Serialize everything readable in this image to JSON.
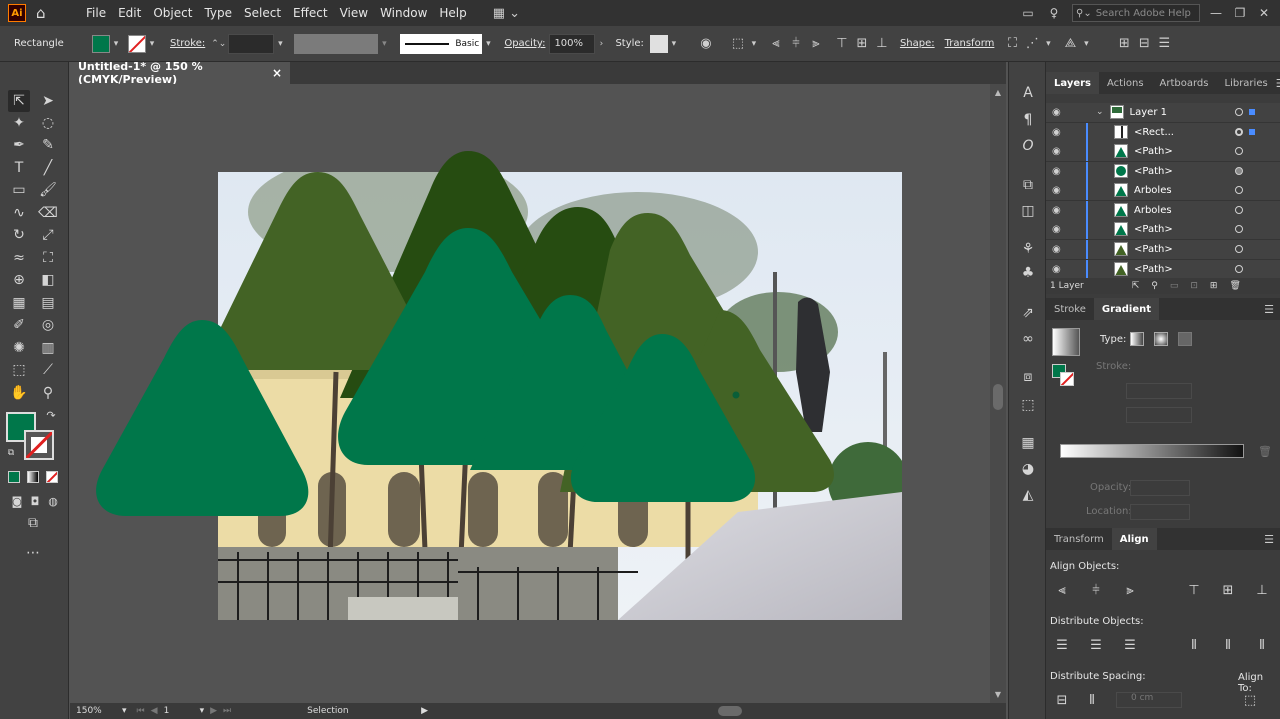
{
  "app": {
    "logo": "Ai",
    "menus": [
      "File",
      "Edit",
      "Object",
      "Type",
      "Select",
      "Effect",
      "View",
      "Window",
      "Help"
    ],
    "search_placeholder": "Search Adobe Help",
    "home_icon": "home-icon"
  },
  "control_bar": {
    "object_type": "Rectangle",
    "fill_color": "#00774a",
    "stroke_label": "Stroke:",
    "brush_label": "Basic",
    "opacity_label": "Opacity:",
    "opacity_value": "100%",
    "style_label": "Style:",
    "shape_label": "Shape:",
    "transform_label": "Transform"
  },
  "document": {
    "tab_title": "Untitled-1* @ 150 % (CMYK/Preview)",
    "close": "×"
  },
  "status_bar": {
    "zoom": "150%",
    "artboard_number": "1",
    "tool_name": "Selection"
  },
  "layers_panel": {
    "tabs": [
      "Layers",
      "Actions",
      "Artboards",
      "Libraries"
    ],
    "rows": [
      {
        "name": "Layer 1",
        "kind": "layer"
      },
      {
        "name": "<Rect...",
        "kind": "rect"
      },
      {
        "name": "<Path>",
        "kind": "path"
      },
      {
        "name": "<Path>",
        "kind": "circle"
      },
      {
        "name": "Arboles",
        "kind": "path"
      },
      {
        "name": "Arboles",
        "kind": "path"
      },
      {
        "name": "<Path>",
        "kind": "path"
      },
      {
        "name": "<Path>",
        "kind": "path-dark"
      },
      {
        "name": "<Path>",
        "kind": "path-dark"
      }
    ],
    "footer": "1 Layer"
  },
  "gradient_panel": {
    "tabs": [
      "Stroke",
      "Gradient"
    ],
    "type_label": "Type:",
    "stroke_label": "Stroke:",
    "opacity_label": "Opacity:",
    "location_label": "Location:"
  },
  "align_panel": {
    "tabs": [
      "Transform",
      "Align"
    ],
    "align_objects_label": "Align Objects:",
    "distribute_objects_label": "Distribute Objects:",
    "distribute_spacing_label": "Distribute Spacing:",
    "spacing_value": "0 cm",
    "align_to_label": "Align To:"
  },
  "colors": {
    "green_bright": "#00774a",
    "green_olive": "#436325",
    "green_dark": "#264c11",
    "ui_dark": "#323232",
    "ui_mid": "#424242"
  }
}
